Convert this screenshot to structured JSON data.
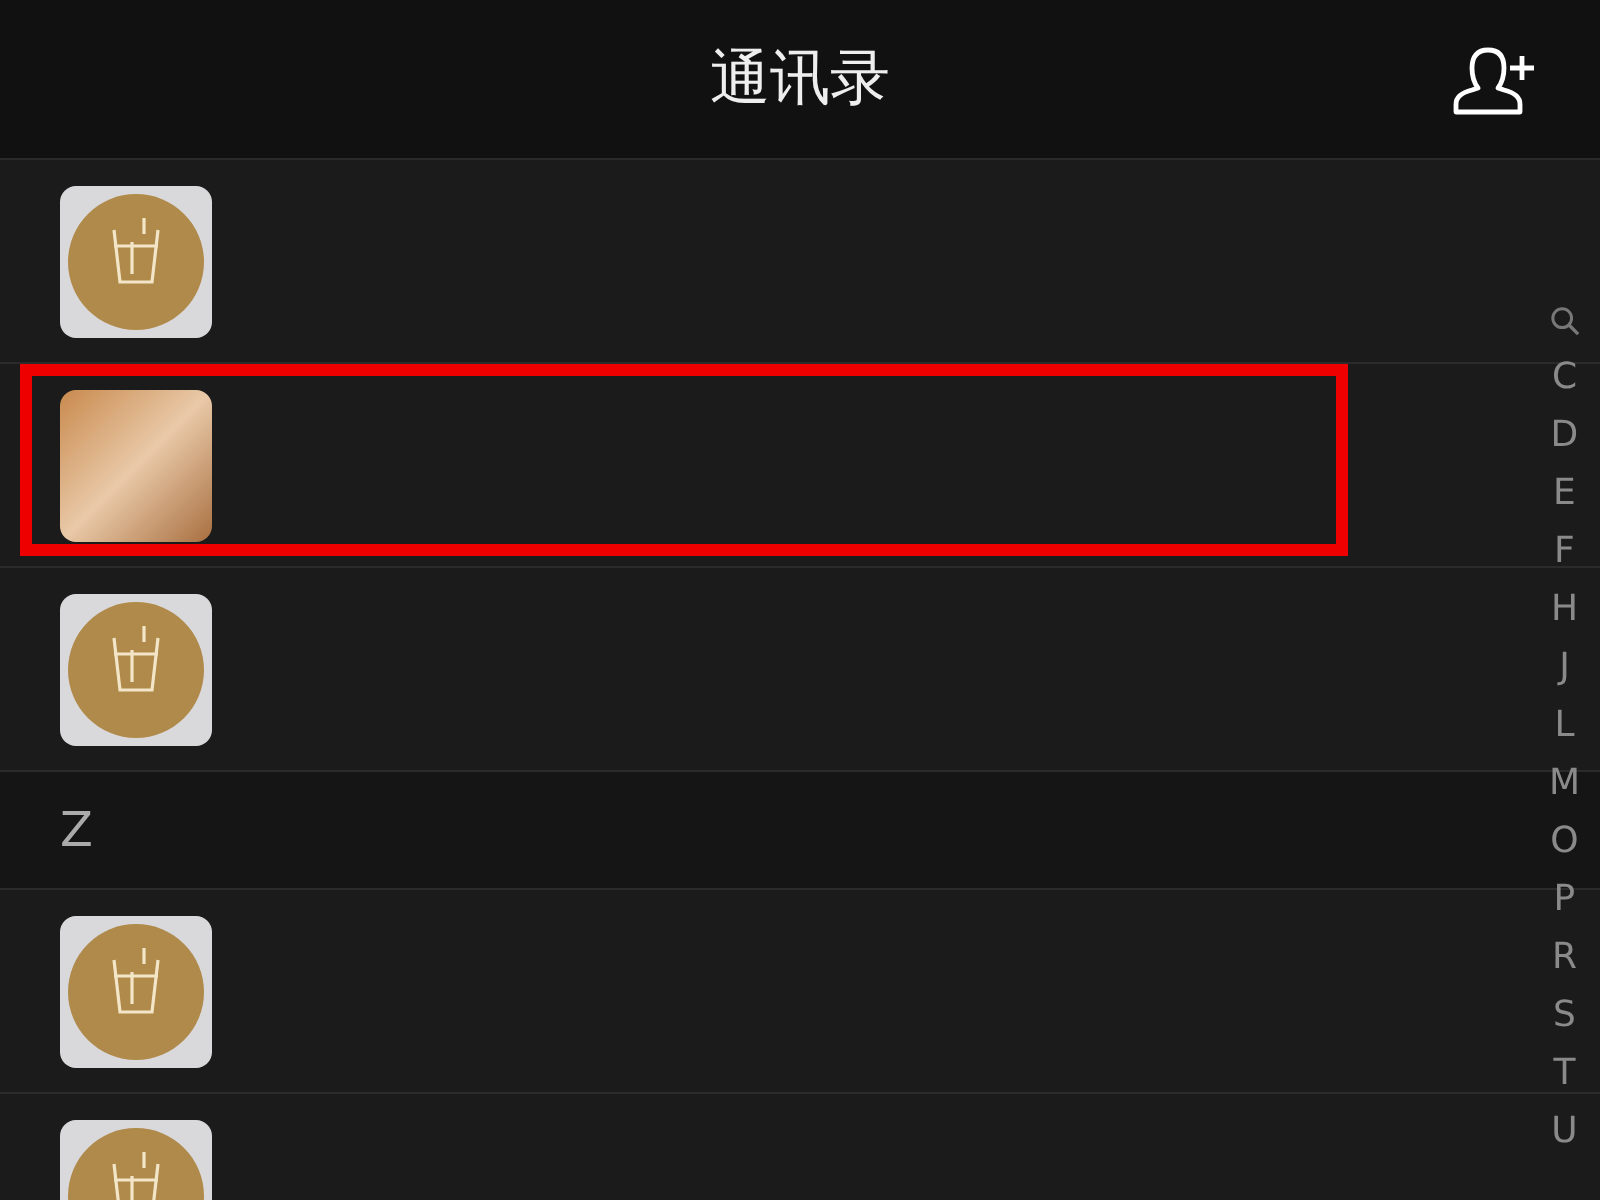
{
  "header": {
    "title": "通讯录"
  },
  "sections": [
    {
      "contacts": [
        {
          "kind": "logo",
          "highlighted": false
        },
        {
          "kind": "photo",
          "highlighted": true
        },
        {
          "kind": "logo",
          "highlighted": false
        }
      ]
    },
    {
      "letter": "Z",
      "contacts": [
        {
          "kind": "logo",
          "highlighted": false
        },
        {
          "kind": "logo",
          "highlighted": false
        }
      ]
    }
  ],
  "index": [
    "C",
    "D",
    "E",
    "F",
    "H",
    "J",
    "L",
    "M",
    "O",
    "P",
    "R",
    "S",
    "T",
    "U"
  ]
}
